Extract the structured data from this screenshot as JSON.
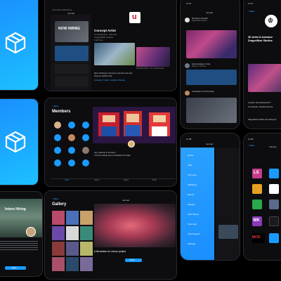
{
  "colors": {
    "accent": "#1a9bff",
    "bg": "#0d0d0f",
    "text": "#e9ecf1",
    "muted": "#8c919a"
  },
  "tablet_top": {
    "status_left": "Unconfigured Mainframe",
    "nav_title": "Journal",
    "side_items": [
      "NOW HIRING",
      "",
      ""
    ],
    "post_title": "Concept Artist",
    "post_lines": [
      "Unreal Engine · Remote",
      "DragonBear Studios",
      "Full-Time"
    ],
    "right_caption": "Illustration Belle - R.A. Ilm Dimension",
    "body_lines": [
      "We're looking for someone to join the team and",
      "bring our worlds to life."
    ],
    "footer": "Artstation | Twitter | LinkedIn | Website"
  },
  "tablet_mid": {
    "back": "< Back",
    "section_title": "Members",
    "caption_lines": [
      "Hey, welcome to the team!",
      "Your first weekly sync is scheduled for Friday."
    ],
    "tabs": [
      "Home",
      "Search",
      "Saved",
      "Profile"
    ]
  },
  "tablet_bottom_left": {
    "title": "Intern Hiring",
    "button": "Apply"
  },
  "tablet_bottom_mid": {
    "back": "< Back",
    "nav_title": "Journal",
    "section_title": "Gallery",
    "caption": "A illustration for school project",
    "follow_button": "Follow"
  },
  "phone_mid_top": {
    "time": "11:47",
    "title": "Journal",
    "posts": [
      {
        "name": "3D Artist & Animator",
        "sub": "DragonBear Studios"
      },
      {
        "name": "Game Engineer | Unity",
        "sub": "Remote · Full-Time"
      },
      {
        "name": "A illustration for school project",
        "sub": ""
      }
    ]
  },
  "phone_mid_bottom": {
    "time": "11:48",
    "title": "Journal",
    "menu": [
      "Home",
      "Jobs",
      "The Loop",
      "Following",
      "Events",
      "Industry",
      "Post Stories",
      "Post Jobs",
      "Post Projects",
      "Settings"
    ]
  },
  "phone_right_top": {
    "time": "11:47",
    "back": "< Back",
    "title_lines": [
      "3D Artist & Animator",
      "DragonBear Studios"
    ],
    "info_lines": [
      "Location: Remote/Austin/TX",
      "5-10 Months, Flexible Full-time",
      "DragonBear Studios are looking for"
    ]
  },
  "phone_right_bottom": {
    "time": "11:48",
    "back": "< Back",
    "title": "Industry",
    "tiles": [
      "LS",
      "MK",
      "MOD"
    ]
  }
}
